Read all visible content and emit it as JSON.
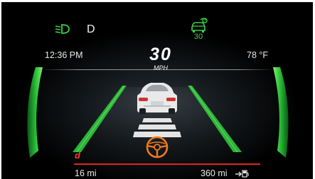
{
  "status_bar": {
    "gear": "D",
    "cruise_set_speed": "30",
    "headlight_icon": "low-beam-headlight-icon",
    "cruise_icon": "adaptive-cruise-control-icon"
  },
  "info_row": {
    "time": "12:36 PM",
    "speed": "30",
    "speed_unit": "MPH",
    "outside_temp": "78 °F"
  },
  "bottom_row": {
    "drive_mode": "d",
    "trip_distance": "16  mi",
    "range": "360 mi",
    "fuel_icon": "fuel-pump-arrow-icon"
  },
  "colors": {
    "background": "#000000",
    "indicator_green": "#3bd14a",
    "lane_green": "#2fd23f",
    "drive_mode_red": "#e1251b",
    "steering_orange": "#f07a1e"
  }
}
